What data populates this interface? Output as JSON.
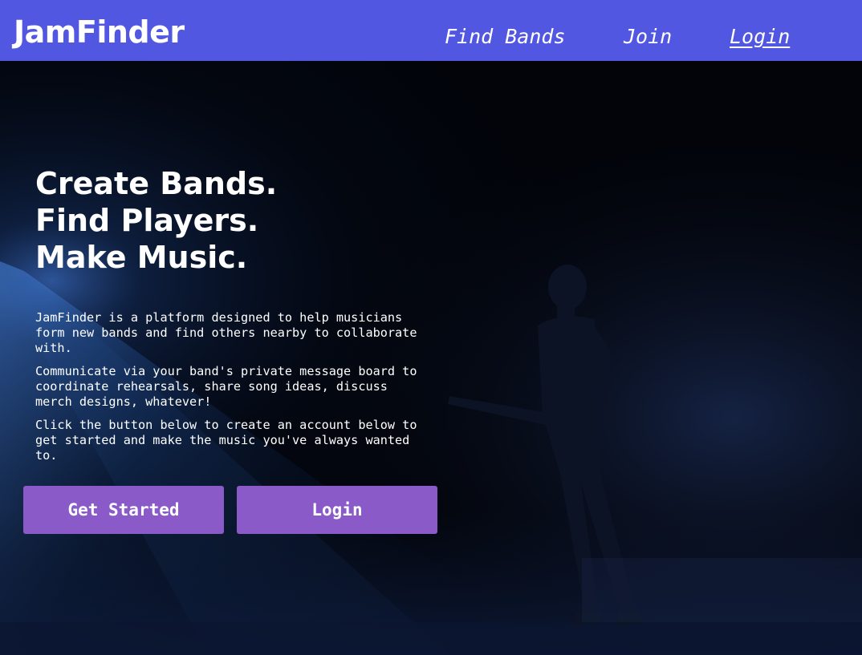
{
  "navbar": {
    "brand": "JamFinder",
    "links": [
      {
        "label": "Find Bands"
      },
      {
        "label": "Join"
      },
      {
        "label": "Login"
      }
    ],
    "color": "#5257e2"
  },
  "hero": {
    "headline": [
      "Create Bands.",
      "Find Players.",
      "Make Music."
    ],
    "paragraphs": [
      "JamFinder is a platform designed to help musicians form new bands and find others nearby to collaborate with.",
      "Communicate via your band's private message board to coordinate rehearsals, share song ideas, discuss merch designs, whatever!",
      "Click the button below to create an account below to get started and make the music you've always wanted to."
    ],
    "buttons": {
      "get_started": "Get Started",
      "login": "Login"
    },
    "button_color": "#8a5bc8",
    "background": "concert-performer-photo"
  }
}
